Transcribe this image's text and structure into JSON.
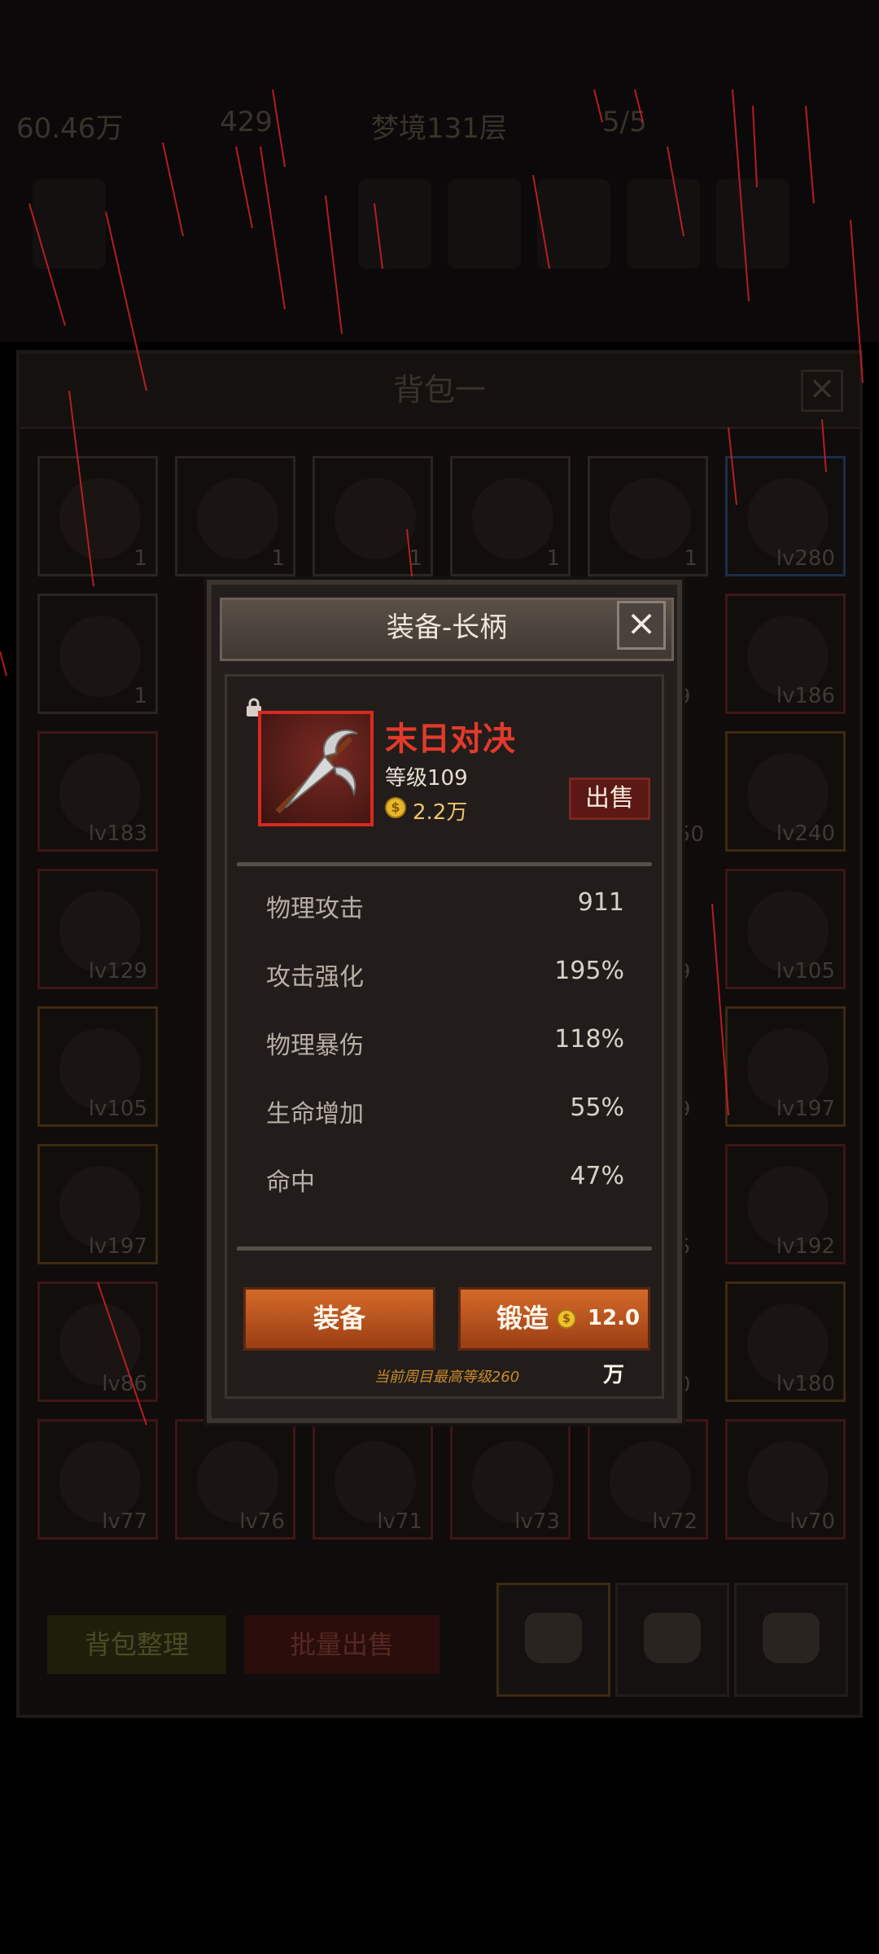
{
  "background": {
    "hud": {
      "gold": "60.46万",
      "gems": "429",
      "stage": "梦境131层",
      "keys": "5/5"
    },
    "bag": {
      "title": "背包一",
      "close_icon": "close-icon",
      "cells": [
        {
          "count": "1",
          "icon": "cake-icon",
          "frame": "gray"
        },
        {
          "count": "1",
          "icon": "cake-icon",
          "frame": "gray"
        },
        {
          "count": "1",
          "icon": "cake-icon",
          "frame": "gray"
        },
        {
          "count": "1",
          "icon": "cake-icon",
          "frame": "gray"
        },
        {
          "count": "1",
          "icon": "cake-icon",
          "frame": "gray"
        },
        {
          "count": "lv280",
          "icon": "orb-icon",
          "frame": "blue"
        },
        {
          "count": "1",
          "icon": "beer-mug-icon",
          "frame": "gray"
        },
        {
          "count": "lv186",
          "icon": "boots-icon",
          "frame": "red"
        },
        {
          "count": "lv183",
          "icon": "bow-icon",
          "frame": "red"
        },
        {
          "count": "lv240",
          "icon": "gloves-icon",
          "frame": "orange"
        },
        {
          "count": "lv129",
          "icon": "dagger-icon",
          "frame": "red"
        },
        {
          "count": "lv105",
          "icon": "amulet-icon",
          "frame": "red"
        },
        {
          "count": "lv105",
          "icon": "ring-icon",
          "frame": "orange"
        },
        {
          "count": "lv197",
          "icon": "necklace-icon",
          "frame": "orange"
        },
        {
          "count": "lv197",
          "icon": "necklace-icon",
          "frame": "orange"
        },
        {
          "count": "lv192",
          "icon": "shield-icon",
          "frame": "red"
        },
        {
          "count": "lv86",
          "icon": "helmet-icon",
          "frame": "red"
        },
        {
          "count": "lv180",
          "icon": "armor-icon",
          "frame": "orange"
        },
        {
          "count": "lv77",
          "icon": "claw-icon",
          "frame": "red"
        },
        {
          "count": "lv76",
          "icon": "robe-icon",
          "frame": "red"
        },
        {
          "count": "lv71",
          "icon": "orb-icon",
          "frame": "red"
        },
        {
          "count": "lv73",
          "icon": "ring-icon",
          "frame": "red"
        },
        {
          "count": "lv72",
          "icon": "helmet-icon",
          "frame": "red"
        },
        {
          "count": "lv70",
          "icon": "armor-icon",
          "frame": "red"
        }
      ],
      "hidden_counts": [
        "9",
        "50",
        "9",
        "9",
        "5",
        "0"
      ],
      "sort_label": "背包整理",
      "bulk_sell_label": "批量出售",
      "tabs": [
        "bag-tab-1",
        "bag-tab-2",
        "bag-tab-3"
      ]
    }
  },
  "dialog": {
    "title": "装备-长柄",
    "item": {
      "name": "末日对决",
      "level": "等级109",
      "price": "2.2万",
      "icon": "polearm-icon",
      "locked_icon": "lock-icon",
      "name_color": "#e23a2c"
    },
    "sell_label": "出售",
    "stats": [
      {
        "name": "物理攻击",
        "value": "911"
      },
      {
        "name": "攻击强化",
        "value": "195%"
      },
      {
        "name": "物理暴伤",
        "value": "118%"
      },
      {
        "name": "生命增加",
        "value": "55%"
      },
      {
        "name": "命中",
        "value": "47%"
      }
    ],
    "equip_label": "装备",
    "forge_label": "锻造",
    "forge_cost": "12.0万",
    "cap_note": "当前周目最高等级260"
  },
  "colors": {
    "accent_orange": "#c85a22",
    "rarity_red": "#d62a22",
    "gold": "#ecc36a"
  }
}
